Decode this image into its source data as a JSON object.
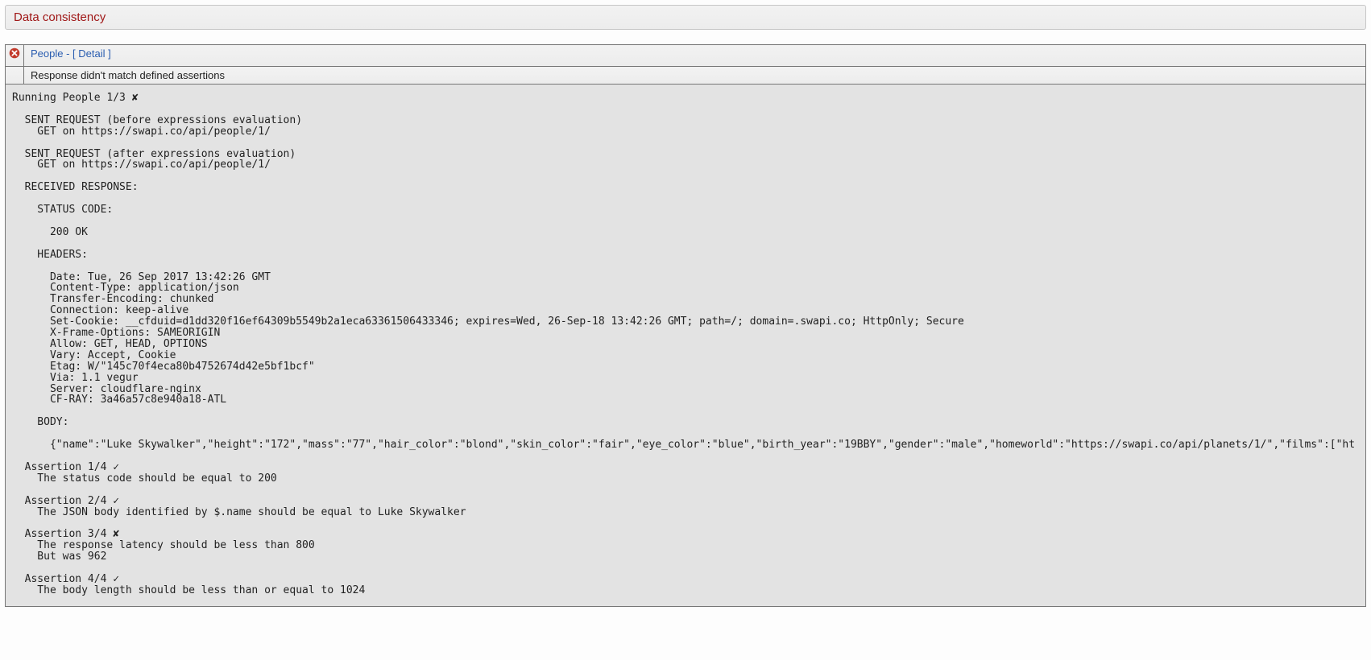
{
  "title": "Data consistency",
  "row": {
    "link_text": "People - [ Detail ]",
    "message": "Response didn't match defined assertions"
  },
  "log": "Running People 1/3 ✘\n\n  SENT REQUEST (before expressions evaluation)\n    GET on https://swapi.co/api/people/1/\n\n  SENT REQUEST (after expressions evaluation)\n    GET on https://swapi.co/api/people/1/\n\n  RECEIVED RESPONSE:\n\n    STATUS CODE:\n\n      200 OK\n\n    HEADERS:\n\n      Date: Tue, 26 Sep 2017 13:42:26 GMT\n      Content-Type: application/json\n      Transfer-Encoding: chunked\n      Connection: keep-alive\n      Set-Cookie: __cfduid=d1dd320f16ef64309b5549b2a1eca63361506433346; expires=Wed, 26-Sep-18 13:42:26 GMT; path=/; domain=.swapi.co; HttpOnly; Secure\n      X-Frame-Options: SAMEORIGIN\n      Allow: GET, HEAD, OPTIONS\n      Vary: Accept, Cookie\n      Etag: W/\"145c70f4eca80b4752674d42e5bf1bcf\"\n      Via: 1.1 vegur\n      Server: cloudflare-nginx\n      CF-RAY: 3a46a57c8e940a18-ATL\n\n    BODY:\n\n      {\"name\":\"Luke Skywalker\",\"height\":\"172\",\"mass\":\"77\",\"hair_color\":\"blond\",\"skin_color\":\"fair\",\"eye_color\":\"blue\",\"birth_year\":\"19BBY\",\"gender\":\"male\",\"homeworld\":\"https://swapi.co/api/planets/1/\",\"films\":[\"ht\n\n  Assertion 1/4 ✓\n    The status code should be equal to 200\n\n  Assertion 2/4 ✓\n    The JSON body identified by $.name should be equal to Luke Skywalker\n\n  Assertion 3/4 ✘\n    The response latency should be less than 800\n    But was 962\n\n  Assertion 4/4 ✓\n    The body length should be less than or equal to 1024"
}
